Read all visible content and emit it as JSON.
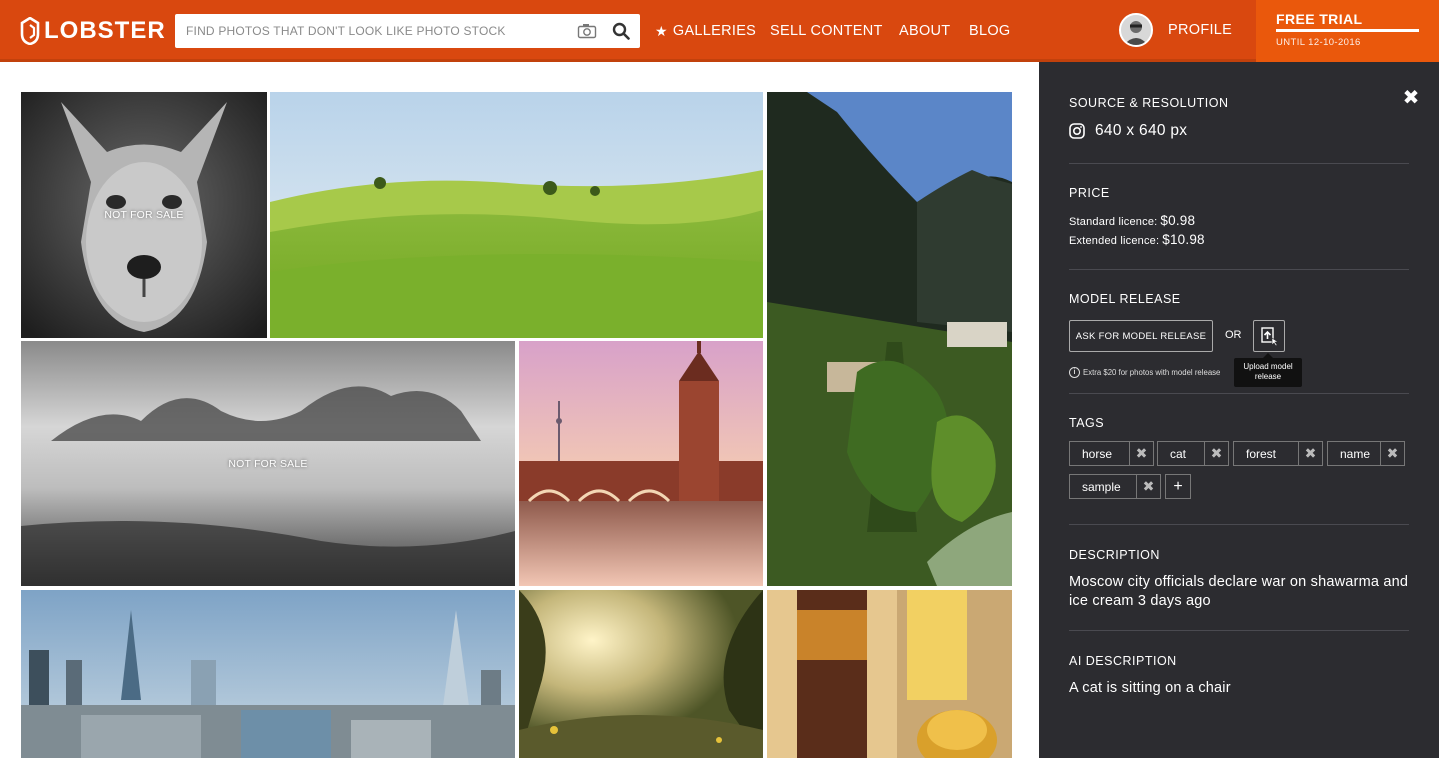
{
  "header": {
    "logo": "LOBSTER",
    "search": {
      "placeholder": "FIND PHOTOS THAT DON'T LOOK LIKE PHOTO STOCK",
      "value": "",
      "camera_icon": "camera-icon",
      "search_icon": "search-icon"
    },
    "nav": {
      "galleries": "GALLERIES",
      "sell": "SELL CONTENT",
      "about": "ABOUT",
      "blog": "BLOG"
    },
    "profile": "PROFILE",
    "trial": {
      "title": "FREE TRIAL",
      "until": "UNTIL 12-10-2016"
    },
    "colors": {
      "brand": "#d9480f",
      "trial": "#ea580c"
    }
  },
  "gallery": {
    "tiles": [
      {
        "subject": "dog",
        "overlay": "NOT FOR SALE"
      },
      {
        "subject": "green-hills",
        "overlay": ""
      },
      {
        "subject": "mountain-valley",
        "overlay": ""
      },
      {
        "subject": "misty-mountains",
        "overlay": "NOT FOR SALE"
      },
      {
        "subject": "bridge-tower",
        "overlay": ""
      },
      {
        "subject": "city-skyline",
        "overlay": ""
      },
      {
        "subject": "forest-sun",
        "overlay": ""
      },
      {
        "subject": "honey",
        "overlay": ""
      }
    ]
  },
  "panel": {
    "close_icon": "close-icon",
    "source": {
      "title": "SOURCE & RESOLUTION",
      "icon": "instagram-icon",
      "resolution": "640 x 640 px"
    },
    "price": {
      "title": "PRICE",
      "standard_label": "Standard licence:",
      "standard_value": "$0.98",
      "extended_label": "Extended licence:",
      "extended_value": "$10.98"
    },
    "model_release": {
      "title": "MODEL RELEASE",
      "ask_button": "ASK FOR MODEL RELEASE",
      "or": "OR",
      "upload_tooltip": "Upload model release",
      "note": "Extra $20 for photos with model release"
    },
    "tags": {
      "title": "TAGS",
      "items": [
        "horse",
        "cat",
        "forest",
        "name",
        "sample"
      ],
      "add": "+"
    },
    "description": {
      "title": "DESCRIPTION",
      "text": "Moscow city officials declare war on shawarma and ice cream 3 days ago"
    },
    "ai_description": {
      "title": "AI DESCRIPTION",
      "text": "A cat is sitting on a chair"
    },
    "colors": {
      "background": "#2c2c30"
    }
  }
}
